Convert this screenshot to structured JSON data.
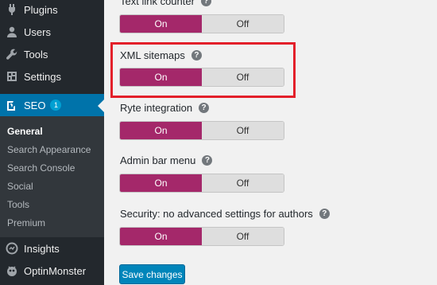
{
  "sidebar": {
    "items": [
      {
        "label": "Plugins",
        "icon": "plugin-icon"
      },
      {
        "label": "Users",
        "icon": "users-icon"
      },
      {
        "label": "Tools",
        "icon": "wrench-icon"
      },
      {
        "label": "Settings",
        "icon": "settings-icon"
      }
    ],
    "seo": {
      "label": "SEO",
      "badge": "1",
      "icon": "yoast-icon"
    },
    "submenu": [
      "General",
      "Search Appearance",
      "Search Console",
      "Social",
      "Tools",
      "Premium"
    ],
    "bottom": [
      {
        "label": "Insights",
        "icon": "insights-icon"
      },
      {
        "label": "OptinMonster",
        "icon": "optinmonster-icon"
      }
    ]
  },
  "settings": [
    {
      "label": "Text link counter",
      "on": "On",
      "off": "Off",
      "selected": "On"
    },
    {
      "label": "XML sitemaps",
      "on": "On",
      "off": "Off",
      "selected": "On"
    },
    {
      "label": "Ryte integration",
      "on": "On",
      "off": "Off",
      "selected": "On"
    },
    {
      "label": "Admin bar menu",
      "on": "On",
      "off": "Off",
      "selected": "On"
    },
    {
      "label": "Security: no advanced settings for authors",
      "on": "On",
      "off": "Off",
      "selected": "On"
    }
  ],
  "help_glyph": "?",
  "save_label": "Save changes",
  "colors": {
    "toggle_on": "#a4286a",
    "highlight": "#e3202a",
    "sidebar": "#23282d",
    "active": "#0073aa"
  }
}
